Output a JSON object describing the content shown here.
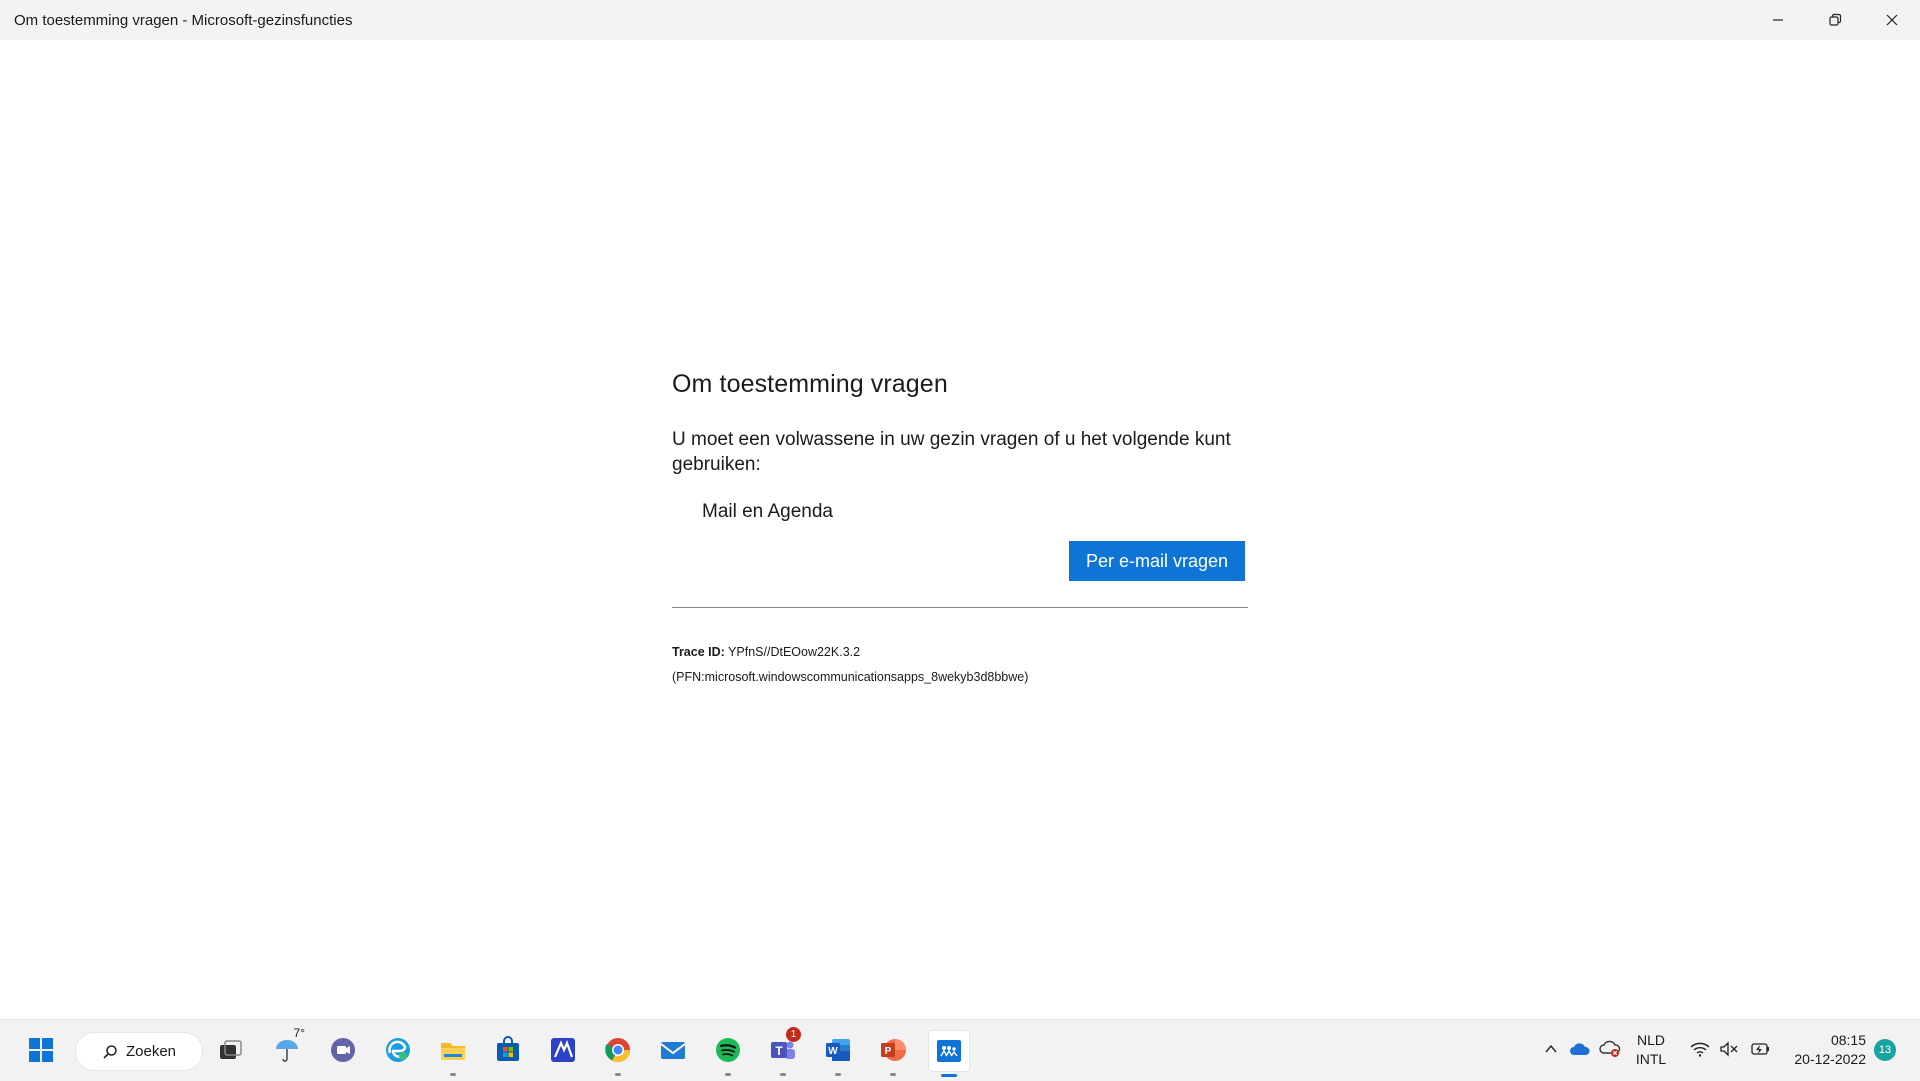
{
  "window": {
    "title": "Om toestemming vragen - Microsoft-gezinsfuncties"
  },
  "page": {
    "heading": "Om toestemming vragen",
    "description": "U moet een volwassene in uw gezin vragen of u het volgende kunt gebruiken:",
    "app_name": "Mail en Agenda",
    "button_label": "Per e-mail vragen",
    "trace_label": "Trace ID:",
    "trace_id": "YPfnS//DtEOow22K.3.2",
    "pfn": "(PFN:microsoft.windowscommunicationsapps_8wekyb3d8bbwe)"
  },
  "taskbar": {
    "search_label": "Zoeken",
    "weather_temp": "7°",
    "teams_badge": "1",
    "language_line1": "NLD",
    "language_line2": "INTL",
    "time": "08:15",
    "date": "20-12-2022",
    "notification_count": "13",
    "accent_color": "#0e74d6"
  }
}
